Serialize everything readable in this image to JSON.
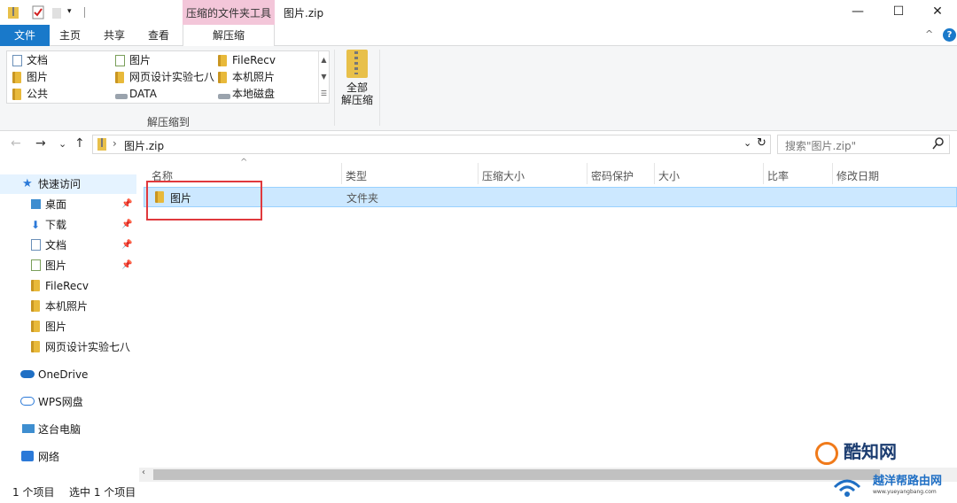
{
  "titlebar": {
    "context_tool": "压缩的文件夹工具",
    "title": "图片.zip",
    "minimize": "—",
    "maximize": "☐",
    "close": "✕"
  },
  "tabs": {
    "file": "文件",
    "home": "主页",
    "share": "共享",
    "view": "查看",
    "extract": "解压缩",
    "collapse": "^",
    "help": "?"
  },
  "ribbon": {
    "destinations": [
      "文档",
      "图片",
      "公共",
      "图片",
      "网页设计实验七八",
      "DATA",
      "FileRecv",
      "本机照片",
      "本地磁盘"
    ],
    "group_label": "解压缩到",
    "extract_all_line1": "全部",
    "extract_all_line2": "解压缩"
  },
  "navbar": {
    "back": "←",
    "forward": "→",
    "recent": "⌄",
    "up": "↑",
    "breadcrumb_sep": "›",
    "path": "图片.zip",
    "dropdown": "⌄",
    "refresh": "↻",
    "search_placeholder": "搜索\"图片.zip\""
  },
  "navpane": {
    "quick_access": "快速访问",
    "items": [
      "桌面",
      "下载",
      "文档",
      "图片",
      "FileRecv",
      "本机照片",
      "图片",
      "网页设计实验七八"
    ],
    "onedrive": "OneDrive",
    "wps": "WPS网盘",
    "thispc": "这台电脑",
    "network": "网络"
  },
  "columns": [
    "名称",
    "类型",
    "压缩大小",
    "密码保护",
    "大小",
    "比率",
    "修改日期"
  ],
  "files": [
    {
      "name": "图片",
      "type": "文件夹"
    }
  ],
  "status": {
    "count": "1 个项目",
    "selected": "选中 1 个项目"
  },
  "watermark": {
    "brand1": "酷知网",
    "brand2": "越洋帮路由网",
    "url": "www.yueyangbang.com"
  },
  "colors": {
    "file_tab": "#1979ca",
    "context_tab": "#f3c6d9",
    "selection": "#cce8ff",
    "highlight_box": "#e0393d"
  }
}
